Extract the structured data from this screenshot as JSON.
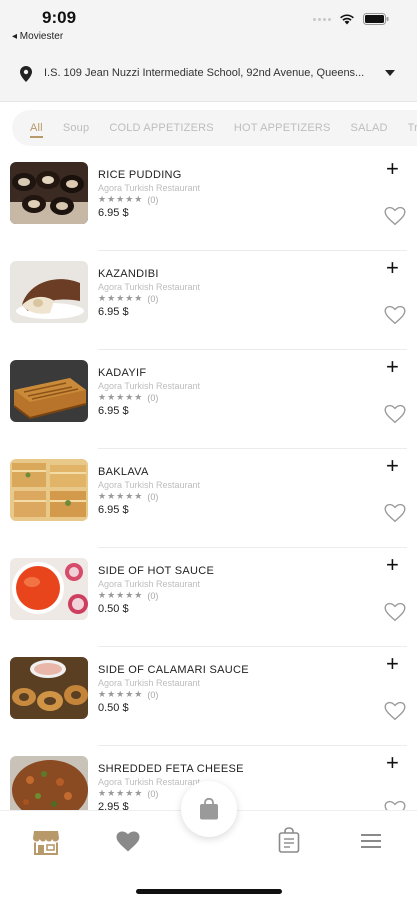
{
  "status": {
    "time": "9:09",
    "back_label": "◂ Moviester"
  },
  "location": {
    "text": "I.S. 109 Jean Nuzzi Intermediate School, 92nd Avenue, Queens..."
  },
  "categories": [
    {
      "label": "All",
      "active": true
    },
    {
      "label": "Soup"
    },
    {
      "label": "COLD APPETIZERS"
    },
    {
      "label": "HOT APPETIZERS"
    },
    {
      "label": "SALAD"
    },
    {
      "label": "Tra"
    }
  ],
  "items": [
    {
      "name": "RICE PUDDING",
      "restaurant": "Agora Turkish Restaurant",
      "stars": "★★★★★",
      "rating_count": "(0)",
      "price": "6.95 $",
      "image": "rice-pudding"
    },
    {
      "name": "KAZANDIBI",
      "restaurant": "Agora Turkish Restaurant",
      "stars": "★★★★★",
      "rating_count": "(0)",
      "price": "6.95 $",
      "image": "kazandibi"
    },
    {
      "name": "KADAYIF",
      "restaurant": "Agora Turkish Restaurant",
      "stars": "★★★★★",
      "rating_count": "(0)",
      "price": "6.95 $",
      "image": "kadayif"
    },
    {
      "name": "BAKLAVA",
      "restaurant": "Agora Turkish Restaurant",
      "stars": "★★★★★",
      "rating_count": "(0)",
      "price": "6.95 $",
      "image": "baklava"
    },
    {
      "name": "SIDE OF HOT SAUCE",
      "restaurant": "Agora Turkish Restaurant",
      "stars": "★★★★★",
      "rating_count": "(0)",
      "price": "0.50 $",
      "image": "hot-sauce"
    },
    {
      "name": "SIDE OF CALAMARI SAUCE",
      "restaurant": "Agora Turkish Restaurant",
      "stars": "★★★★★",
      "rating_count": "(0)",
      "price": "0.50 $",
      "image": "calamari-sauce"
    },
    {
      "name": "SHREDDED FETA CHEESE",
      "restaurant": "Agora Turkish Restaurant",
      "stars": "★★★★★",
      "rating_count": "(0)",
      "price": "2.95 $",
      "image": "feta-cheese"
    }
  ],
  "nav": {
    "items": [
      "store-icon",
      "heart-icon",
      "cart-icon",
      "receipt-icon",
      "menu-icon"
    ],
    "active_color": "#b89a6a",
    "inactive_color": "#8a8a8a"
  },
  "colors": {
    "accent": "#b89a6a",
    "status_bg": "#f4f4f4"
  }
}
